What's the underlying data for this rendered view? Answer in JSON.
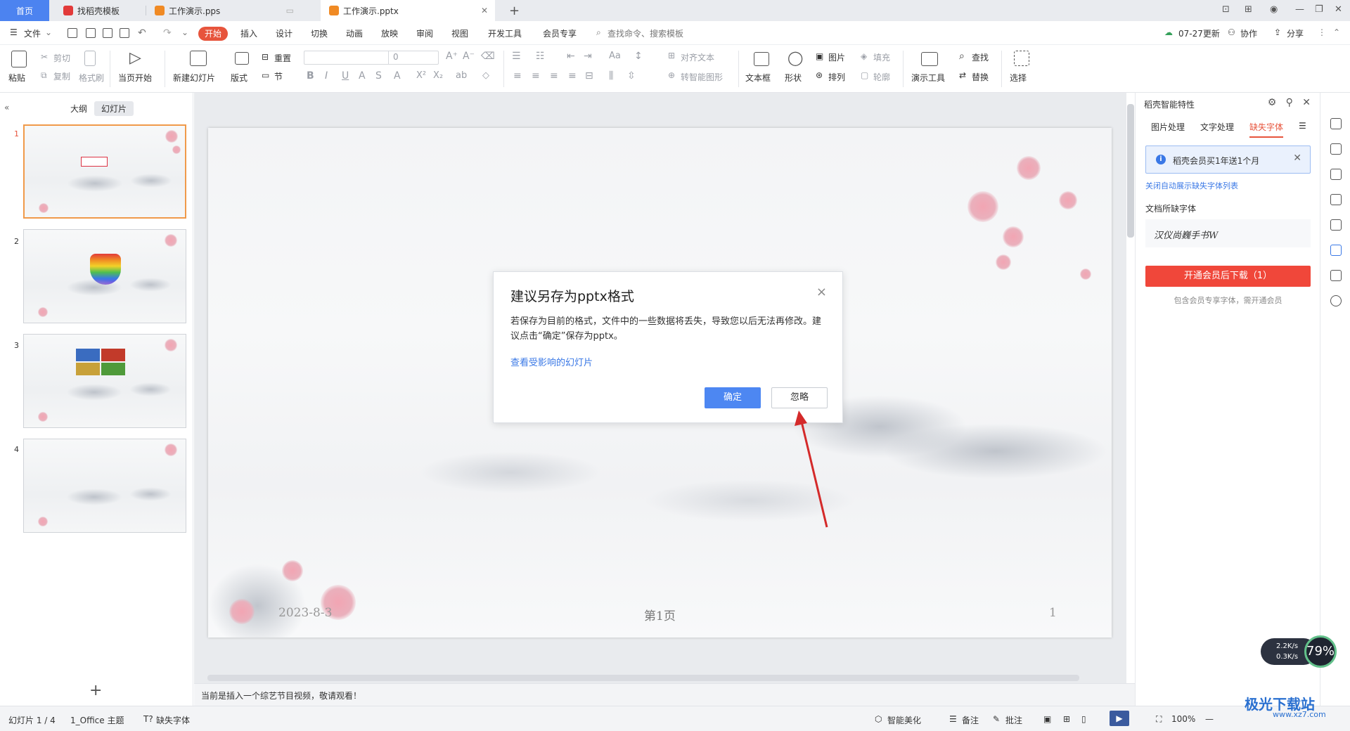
{
  "tabs": {
    "home": "首页",
    "tab1": "找稻壳模板",
    "tab2": "工作演示.pps",
    "tab3": "工作演示.pptx",
    "add": "+"
  },
  "menu": {
    "file": "文件",
    "start": "开始",
    "items": [
      "插入",
      "设计",
      "切换",
      "动画",
      "放映",
      "审阅",
      "视图",
      "开发工具",
      "会员专享"
    ],
    "search": "查找命令、搜索模板",
    "update": "07-27更新",
    "collab": "协作",
    "share": "分享"
  },
  "ribbon": {
    "paste": "粘贴",
    "cut": "剪切",
    "copy": "复制",
    "format_painter": "格式刷",
    "play_current": "当页开始",
    "new_slide": "新建幻灯片",
    "layout": "版式",
    "section": "节",
    "reset": "重置",
    "font_size": "0",
    "align_text": "对齐文本",
    "convert_smartart": "转智能图形",
    "textbox": "文本框",
    "shape": "形状",
    "picture": "图片",
    "arrange": "排列",
    "fill": "填充",
    "outline": "轮廓",
    "present_tools": "演示工具",
    "find": "查找",
    "replace": "替换",
    "select": "选择"
  },
  "leftpane": {
    "outline_tab": "大纲",
    "slides_tab": "幻灯片",
    "slide_numbers": [
      "1",
      "2",
      "3",
      "4"
    ],
    "add": "+"
  },
  "slide": {
    "date": "2023-8-3",
    "page_label": "第1页",
    "number": "1"
  },
  "dialog": {
    "title": "建议另存为pptx格式",
    "body": "若保存为目前的格式，文件中的一些数据将丢失，导致您以后无法再修改。建议点击“确定”保存为pptx。",
    "link": "查看受影响的幻灯片",
    "ok": "确定",
    "ignore": "忽略",
    "close": "×"
  },
  "rightpane": {
    "title": "稻壳智能特性",
    "tabs": [
      "图片处理",
      "文字处理",
      "缺失字体"
    ],
    "notice": "稻壳会员买1年送1个月",
    "auto_link": "关闭自动展示缺失字体列表",
    "missing_label": "文档所缺字体",
    "font_sample": "汉仪尚巍手书W",
    "download_btn": "开通会员后下载（1）",
    "note": "包含会员专享字体，需开通会员"
  },
  "notes": {
    "text": "当前是插入一个综艺节目视频，敬请观看！"
  },
  "status": {
    "slide_info": "幻灯片 1 / 4",
    "theme": "1_Office 主题",
    "missing_font": "缺失字体",
    "beautify": "智能美化",
    "remarks": "备注",
    "comments": "批注",
    "zoom": "100%"
  },
  "speed": {
    "up": "2.2K/s",
    "down": "0.3K/s",
    "percent": "79%"
  },
  "watermark": {
    "name": "极光下载站",
    "url": "www.xz7.com"
  },
  "colors": {
    "accent": "#e7543c",
    "primary_btn": "#4d87f2",
    "link": "#3a78e6",
    "home_tab": "#4c83f0",
    "arrow": "#d42a2a"
  }
}
